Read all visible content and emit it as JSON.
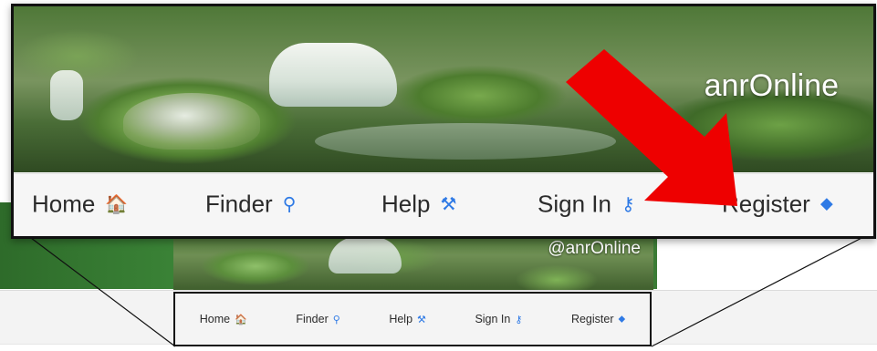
{
  "colors": {
    "accent_icon": "#2f7ae5",
    "arrow": "#ee0000",
    "frame": "#111111",
    "nav_bg": "#f6f6f6"
  },
  "callout": {
    "brand_text": "anrOnline",
    "nav": [
      {
        "label": "Home",
        "icon": "home-icon",
        "glyph": "🏠"
      },
      {
        "label": "Finder",
        "icon": "search-icon",
        "glyph": "⚲"
      },
      {
        "label": "Help",
        "icon": "wrench-icon",
        "glyph": "⚒"
      },
      {
        "label": "Sign In",
        "icon": "key-icon",
        "glyph": "⚷"
      },
      {
        "label": "Register",
        "icon": "tag-icon",
        "glyph": "⬥"
      }
    ]
  },
  "background_page": {
    "brand_text": "@anrOnline",
    "nav": [
      {
        "label": "Home",
        "icon": "home-icon",
        "glyph": "🏠"
      },
      {
        "label": "Finder",
        "icon": "search-icon",
        "glyph": "⚲"
      },
      {
        "label": "Help",
        "icon": "wrench-icon",
        "glyph": "⚒"
      },
      {
        "label": "Sign In",
        "icon": "key-icon",
        "glyph": "⚷"
      },
      {
        "label": "Register",
        "icon": "tag-icon",
        "glyph": "⬥"
      }
    ]
  },
  "annotation": {
    "arrow_icon": "red-arrow-icon"
  }
}
